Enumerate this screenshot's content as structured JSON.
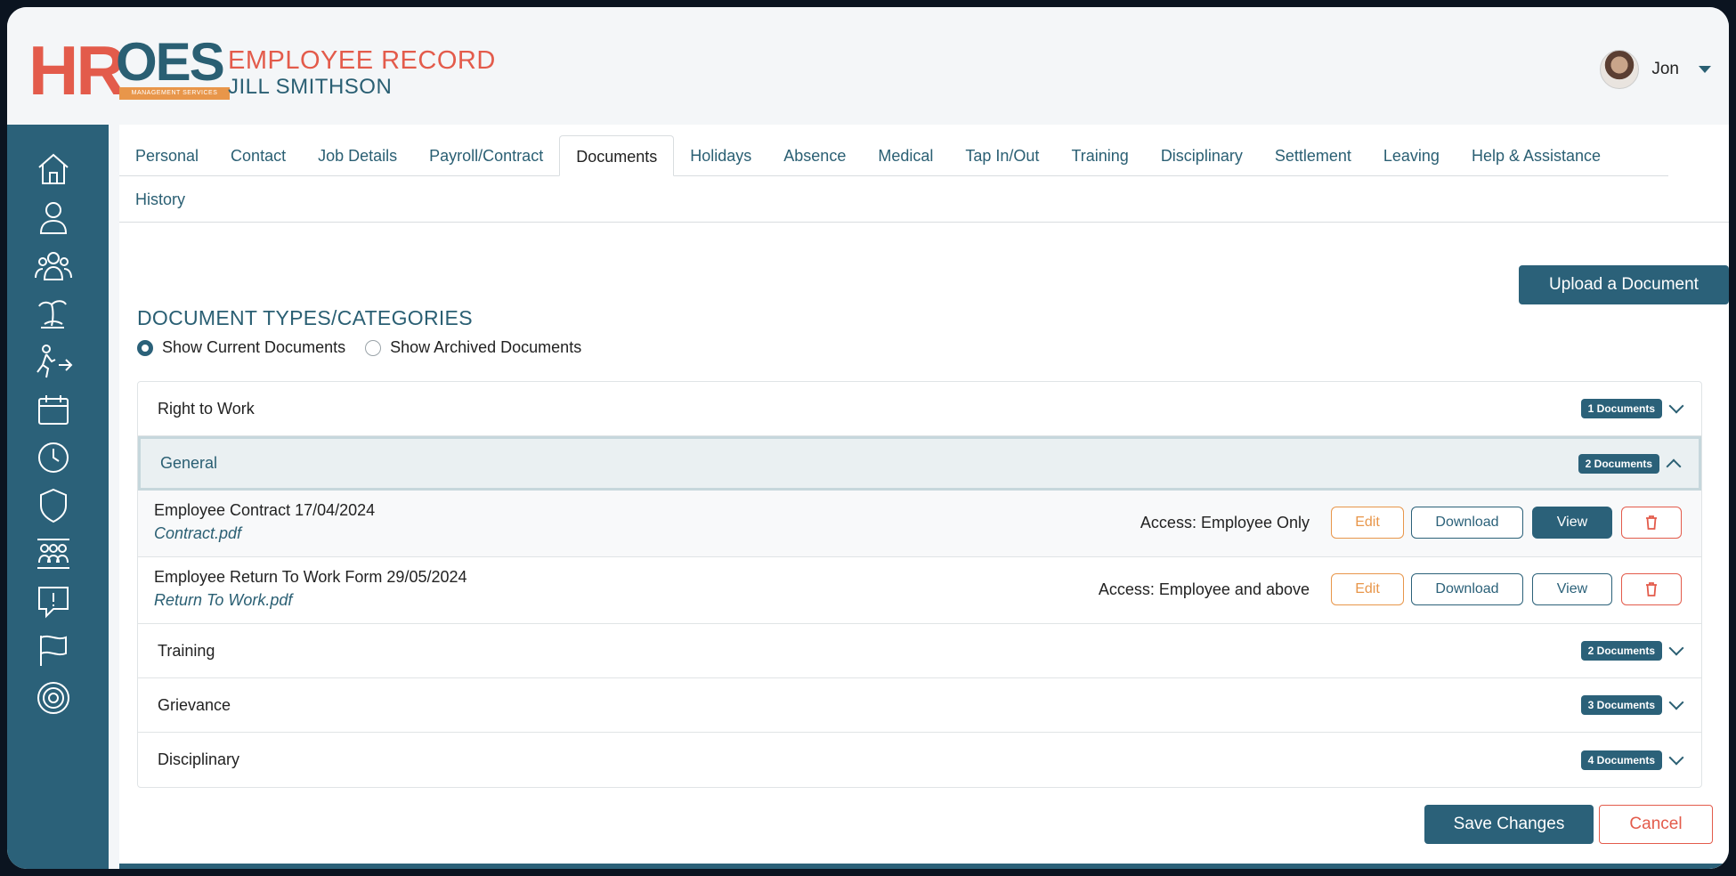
{
  "header": {
    "logo_hr": "HR",
    "logo_oes": "OES",
    "logo_tag": "MANAGEMENT SERVICES",
    "title": "EMPLOYEE RECORD",
    "employee_name": "JILL SMITHSON",
    "user_name": "Jon"
  },
  "sidebar": {
    "icons": [
      "home-icon",
      "person-icon",
      "group-icon",
      "holiday-icon",
      "leaving-icon",
      "calendar-icon",
      "clock-icon",
      "shield-icon",
      "team-icon",
      "alert-icon",
      "flag-icon",
      "target-icon"
    ]
  },
  "tabs": {
    "row1": [
      "Personal",
      "Contact",
      "Job Details",
      "Payroll/Contract",
      "Documents",
      "Holidays",
      "Absence",
      "Medical",
      "Tap In/Out",
      "Training",
      "Disciplinary",
      "Settlement",
      "Leaving",
      "Help & Assistance"
    ],
    "row2": [
      "History"
    ],
    "active": "Documents"
  },
  "documents": {
    "upload_label": "Upload a Document",
    "section_title": "DOCUMENT TYPES/CATEGORIES",
    "radio_current": "Show Current Documents",
    "radio_archived": "Show Archived Documents",
    "categories": [
      {
        "name": "Right to Work",
        "count": "1 Documents",
        "open": false
      },
      {
        "name": "General",
        "count": "2 Documents",
        "open": true
      },
      {
        "name": "Training",
        "count": "2 Documents",
        "open": false
      },
      {
        "name": "Grievance",
        "count": "3 Documents",
        "open": false
      },
      {
        "name": "Disciplinary",
        "count": "4 Documents",
        "open": false
      }
    ],
    "items": [
      {
        "title": "Employee Contract 17/04/2024",
        "file": "Contract.pdf",
        "access": "Access: Employee Only"
      },
      {
        "title": "Employee Return To Work Form 29/05/2024",
        "file": "Return To Work.pdf",
        "access": "Access: Employee and above"
      }
    ],
    "edit_label": "Edit",
    "download_label": "Download",
    "view_label": "View"
  },
  "footer": {
    "save_label": "Save Changes",
    "cancel_label": "Cancel"
  }
}
